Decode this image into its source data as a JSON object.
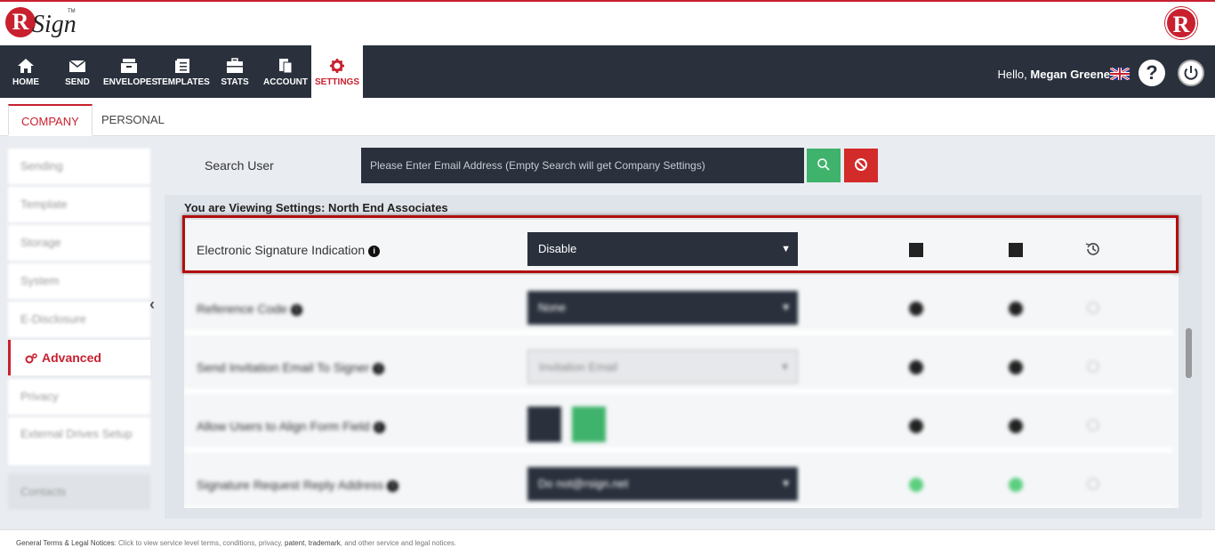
{
  "brand": {
    "logo_letter": "R",
    "logo_text": "Sign",
    "logo_tm": "TM"
  },
  "nav": [
    {
      "label": "HOME",
      "icon": "home-icon"
    },
    {
      "label": "SEND",
      "icon": "envelope-icon"
    },
    {
      "label": "ENVELOPES",
      "icon": "envelopes-icon"
    },
    {
      "label": "TEMPLATES",
      "icon": "templates-icon"
    },
    {
      "label": "STATS",
      "icon": "briefcase-icon"
    },
    {
      "label": "ACCOUNT",
      "icon": "account-icon"
    },
    {
      "label": "SETTINGS",
      "icon": "gear-icon"
    }
  ],
  "user": {
    "greeting": "Hello,",
    "name": "Megan Greene",
    "help": "?"
  },
  "tabs": [
    {
      "label": "COMPANY"
    },
    {
      "label": "PERSONAL"
    }
  ],
  "sidebar": {
    "items": [
      {
        "label": "Sending"
      },
      {
        "label": "Template"
      },
      {
        "label": "Storage"
      },
      {
        "label": "System"
      },
      {
        "label": "E-Disclosure"
      },
      {
        "label": "Advanced"
      },
      {
        "label": "Privacy"
      },
      {
        "label": "External Drives Setup"
      },
      {
        "label": "Contacts"
      }
    ]
  },
  "search": {
    "label": "Search User",
    "placeholder": "Please Enter Email Address (Empty Search will get Company Settings)"
  },
  "panel": {
    "title": "You are Viewing Settings: North End Associates",
    "rows": [
      {
        "label": "Electronic Signature Indication",
        "value": "Disable"
      },
      {
        "label": "Reference Code",
        "value": "None"
      },
      {
        "label": "Send Invitation Email To Signer",
        "value": "Invitation Email"
      },
      {
        "label": "Allow Users to Align Form Field",
        "value": ""
      },
      {
        "label": "Signature Request Reply Address",
        "value": "Do not@rsign.net"
      }
    ]
  },
  "footer": {
    "lead": "General Terms & Legal Notices",
    "text": ": Click to view service level terms, conditions, privacy, ",
    "patent": "patent",
    "sep": ", ",
    "trademark": "trademark",
    "tail": ", and other service and legal notices."
  },
  "colors": {
    "brand_red": "#c8202f",
    "nav_dark": "#2a313d",
    "green": "#3fb36b"
  }
}
